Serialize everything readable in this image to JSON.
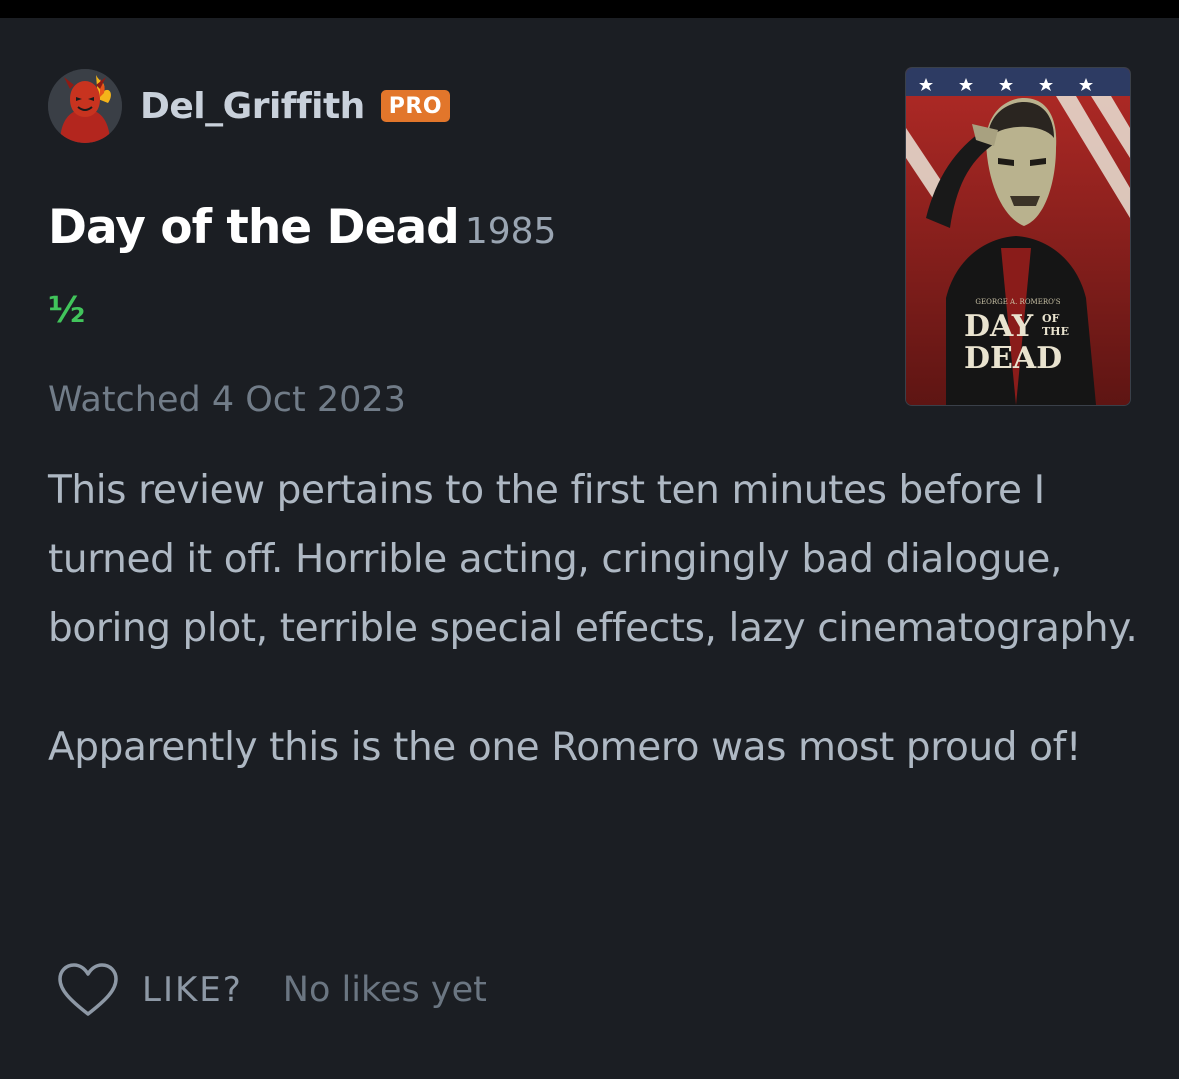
{
  "reviewer": {
    "username": "Del_Griffith",
    "badge": "PRO"
  },
  "film": {
    "title": "Day of the Dead",
    "year": "1985",
    "rating_text": "½",
    "rating_stars": 0.5,
    "poster_text": {
      "credit": "GEORGE A. ROMERO'S",
      "line1": "DAY",
      "of": "OF",
      "the": "THE",
      "line2": "DEAD"
    }
  },
  "watched": "Watched 4 Oct 2023",
  "review": {
    "paragraphs": [
      "This review pertains to the first ten minutes before I turned it off. Horrible acting, cringingly bad dialogue, boring plot, terrible special effects, lazy cinematography.",
      "Apparently this is the one Romero was most proud of!"
    ]
  },
  "actions": {
    "like_label": "LIKE?",
    "likes_status": "No likes yet"
  },
  "colors": {
    "background": "#1b1e23",
    "badge": "#e2762b",
    "rating": "#41c45b"
  }
}
